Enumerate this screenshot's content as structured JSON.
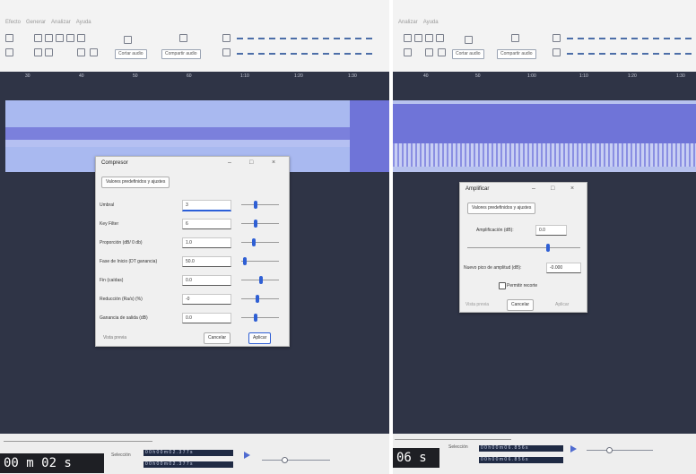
{
  "left": {
    "menu": [
      "Efecto",
      "Generar",
      "Analizar",
      "Ayuda"
    ],
    "toolbar": {
      "trim_label": "Cortar audio",
      "silence_label": "Compartir audio"
    },
    "ruler_ticks": [
      "30",
      "40",
      "50",
      "60",
      "1:10",
      "1:20",
      "1:30"
    ],
    "time": "00 m 02 s",
    "selection_label": "Selección",
    "selection_start": "0 0 h 0 0 m 0 2 . 3 7 7 s",
    "selection_end": "0 0 h 0 0 m 0 2 . 3 7 7 s",
    "dialog": {
      "title": "Compresor",
      "presets_label": "Valores predefinidos y ajustes",
      "params": [
        {
          "label": "Umbral",
          "value": "3"
        },
        {
          "label": "Key Filter",
          "value": "6"
        },
        {
          "label": "Proporción (dB/ 0 db)",
          "value": "1.0"
        },
        {
          "label": "Fase de Inicio (DT ganancia)",
          "value": "50.0"
        },
        {
          "label": "Fin (caídas)",
          "value": "0.0"
        },
        {
          "label": "Reducción (Ra/s) (%)",
          "value": "-0"
        },
        {
          "label": "Ganancia de salida (dB)",
          "value": "0.0"
        }
      ],
      "preview_label": "Vista previa",
      "cancel_label": "Cancelar",
      "apply_label": "Aplicar"
    }
  },
  "right": {
    "menu": [
      "Analizar",
      "Ayuda"
    ],
    "toolbar": {
      "trim_label": "Cortar audio",
      "silence_label": "Compartir audio"
    },
    "ruler_ticks": [
      "40",
      "50",
      "1:00",
      "1:10",
      "1:20",
      "1:30"
    ],
    "time": "06 s",
    "selection_label": "Selección",
    "selection_start": "0 0 h 0 0 m 0 6 . 8 5 6 s",
    "selection_end": "0 0 h 0 0 m 0 6 . 8 5 6 s",
    "dialog": {
      "title": "Amplificar",
      "presets_label": "Valores predefinidos y ajustes",
      "amp_label": "Amplificación (dB):",
      "amp_value": "0.0",
      "peak_label": "Nuevo pico de amplitud (dB):",
      "peak_value": "-0.000",
      "clip_label": "Permitir recorte",
      "preview_label": "Vista previa",
      "cancel_label": "Cancelar",
      "apply_label": "Aplicar"
    }
  },
  "colors": {
    "waveform_blue": "#6f74d8",
    "clip_background": "#a9b9f0",
    "track_background": "#2f3446",
    "accent": "#2f5fd4"
  }
}
